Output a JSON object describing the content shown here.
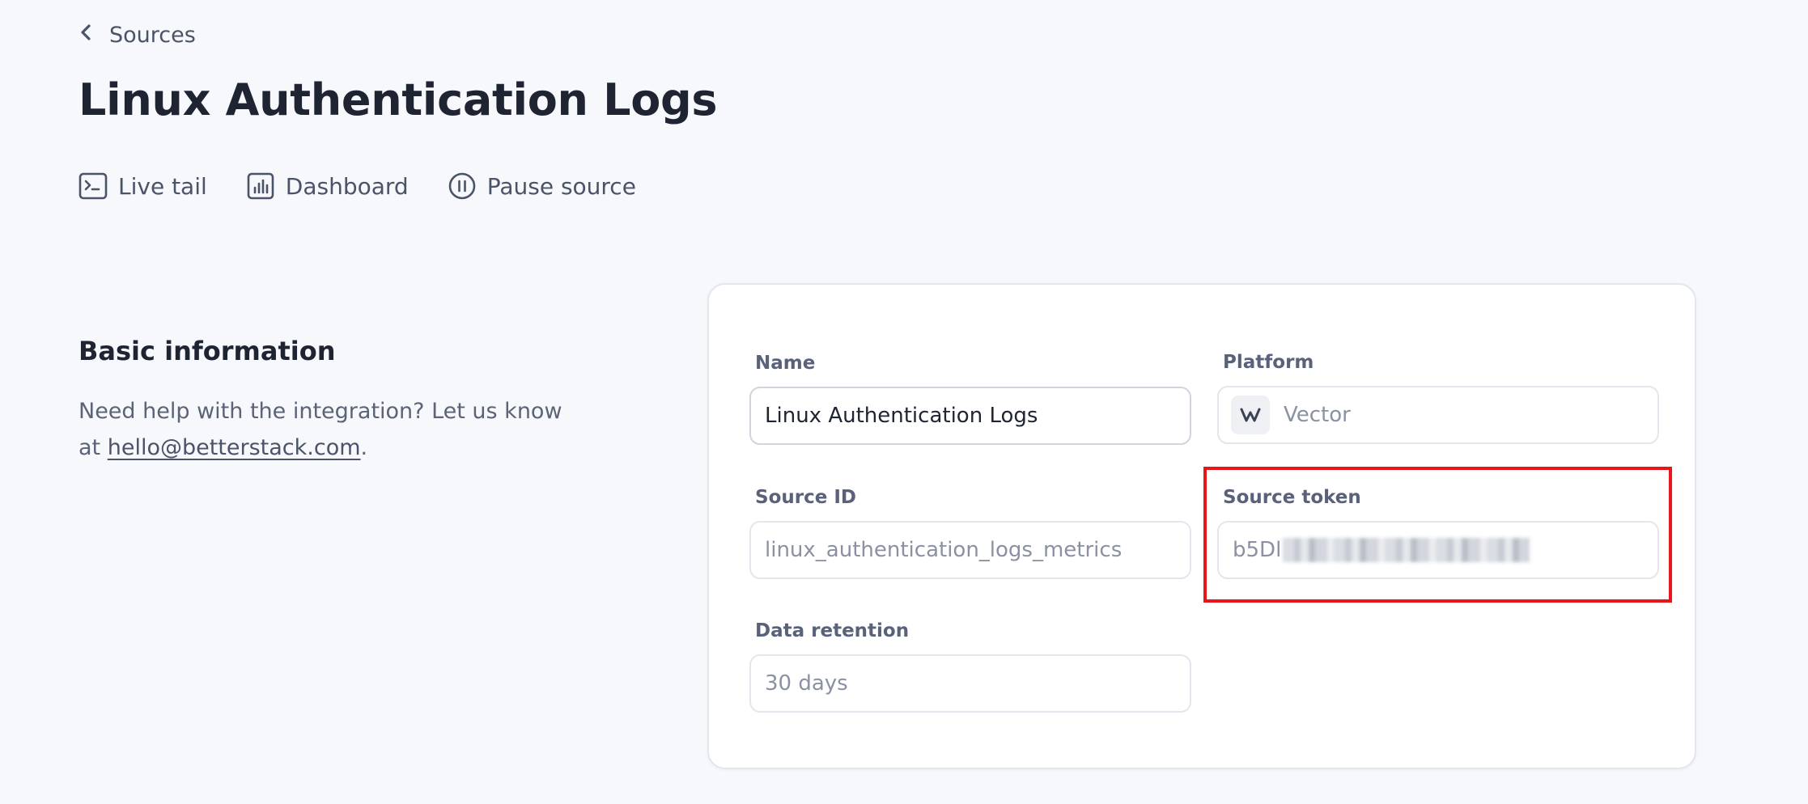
{
  "breadcrumb": {
    "label": "Sources"
  },
  "page": {
    "title": "Linux Authentication Logs"
  },
  "actions": {
    "live_tail": "Live tail",
    "dashboard": "Dashboard",
    "pause_source": "Pause source"
  },
  "basic_info": {
    "title": "Basic information",
    "help_prefix": "Need help with the integration? Let us know at ",
    "help_email": "hello@betterstack.com",
    "help_suffix": "."
  },
  "form": {
    "name": {
      "label": "Name",
      "value": "Linux Authentication Logs"
    },
    "platform": {
      "label": "Platform",
      "value": "Vector",
      "icon": "vector-logo-icon"
    },
    "source_id": {
      "label": "Source ID",
      "value": "linux_authentication_logs_metrics"
    },
    "source_token": {
      "label": "Source token",
      "visible_prefix": "b5Dl",
      "redacted": true
    },
    "data_retention": {
      "label": "Data retention",
      "value": "30 days"
    }
  },
  "colors": {
    "background": "#f6f8fb",
    "highlight": "#e8151b",
    "text_primary": "#1f2433",
    "text_muted": "#5b6377"
  }
}
